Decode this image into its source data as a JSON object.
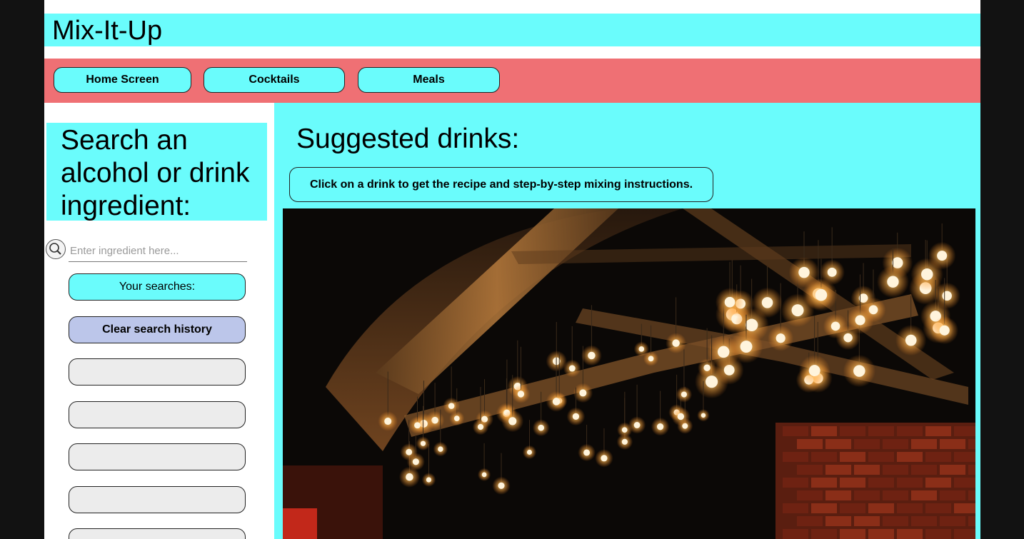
{
  "app": {
    "title": "Mix-It-Up"
  },
  "nav": {
    "items": [
      {
        "label": "Home Screen"
      },
      {
        "label": "Cocktails"
      },
      {
        "label": "Meals"
      }
    ]
  },
  "sidebar": {
    "heading": "Search an alcohol or drink ingredient:",
    "search": {
      "placeholder": "Enter ingredient here...",
      "value": ""
    },
    "searches_label": "Your searches:",
    "clear_label": "Clear search history",
    "history": [
      "",
      "",
      "",
      "",
      ""
    ]
  },
  "main": {
    "title": "Suggested drinks:",
    "instructions": "Click on a drink to get the recipe and step-by-step mixing instructions.",
    "image": {
      "subject": "dimly lit bar interior with hanging light bulbs"
    }
  },
  "colors": {
    "cyan": "#6afcfc",
    "nav_red": "#ef7074",
    "clear_button": "#bcc6ea",
    "history_button": "#ececec"
  }
}
